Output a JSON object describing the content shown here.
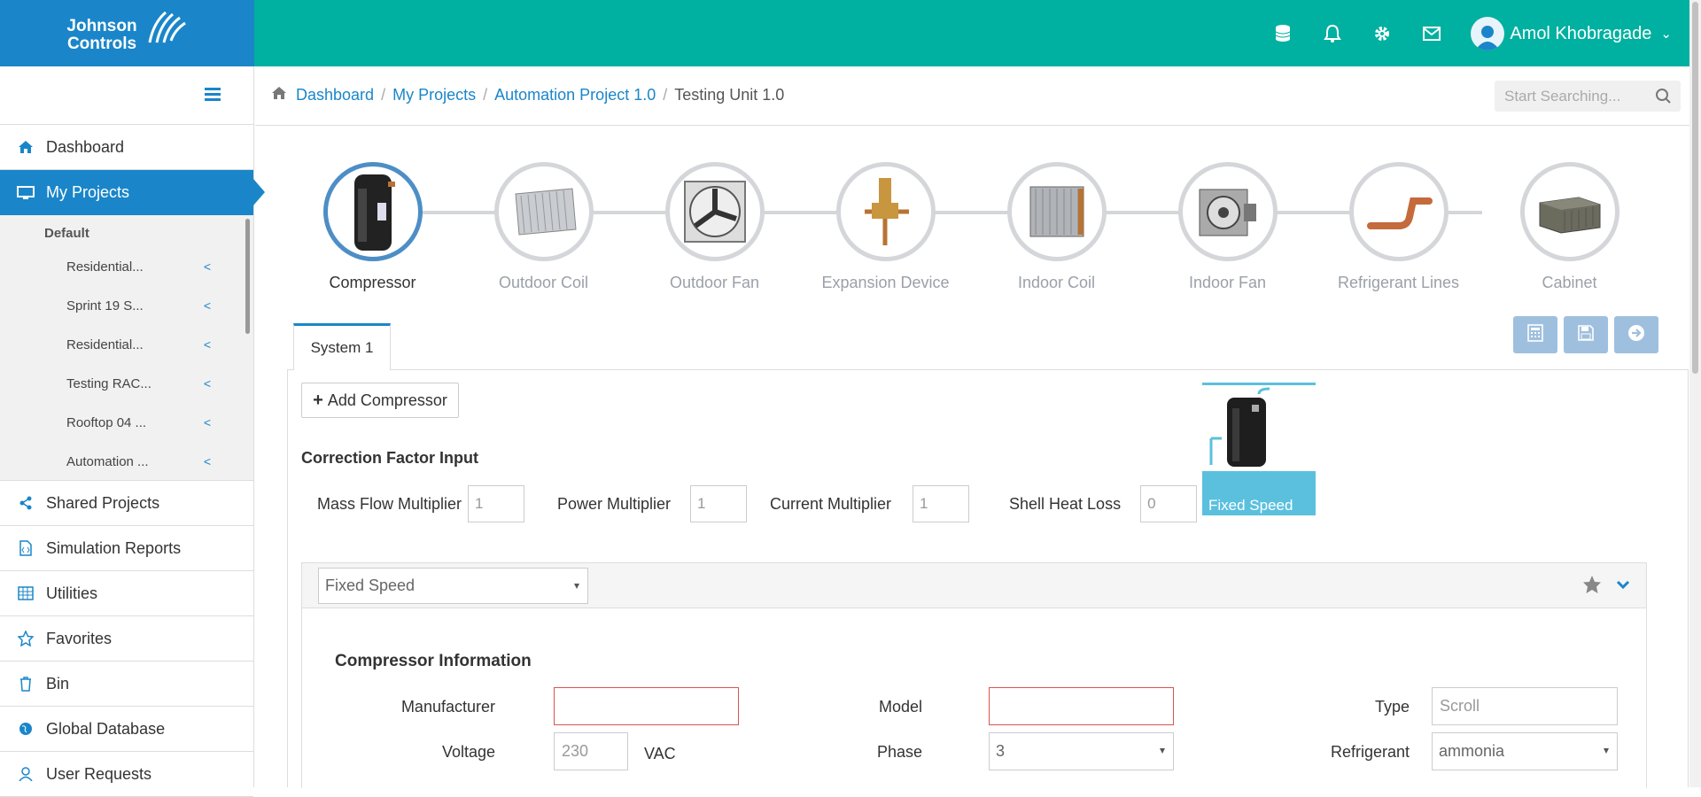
{
  "brand": {
    "line1": "Johnson",
    "line2": "Controls"
  },
  "user": {
    "name": "Amol Khobragade"
  },
  "sidebar": {
    "items_top": [
      {
        "label": "Dashboard",
        "icon": "home-icon"
      },
      {
        "label": "My Projects",
        "icon": "monitor-icon"
      }
    ],
    "group": "Default",
    "projects": [
      "Residential...",
      "Sprint 19 S...",
      "Residential...",
      "Testing RAC...",
      "Rooftop 04 ...",
      "Automation ..."
    ],
    "items_bottom": [
      {
        "label": "Shared Projects",
        "icon": "share-icon"
      },
      {
        "label": "Simulation Reports",
        "icon": "report-icon"
      },
      {
        "label": "Utilities",
        "icon": "grid-icon"
      },
      {
        "label": "Favorites",
        "icon": "star-icon"
      },
      {
        "label": "Bin",
        "icon": "trash-icon"
      },
      {
        "label": "Global Database",
        "icon": "globe-icon"
      },
      {
        "label": "User Requests",
        "icon": "user-icon"
      }
    ]
  },
  "breadcrumb": [
    "Dashboard",
    "My Projects",
    "Automation Project 1.0",
    "Testing Unit 1.0"
  ],
  "search": {
    "placeholder": "Start Searching..."
  },
  "steps": [
    "Compressor",
    "Outdoor Coil",
    "Outdoor Fan",
    "Expansion Device",
    "Indoor Coil",
    "Indoor Fan",
    "Refrigerant Lines",
    "Cabinet"
  ],
  "tab": "System 1",
  "add_compressor": "Add Compressor",
  "correction": {
    "title": "Correction Factor Input",
    "fields": [
      {
        "label": "Mass Flow Multiplier",
        "value": "1"
      },
      {
        "label": "Power Multiplier",
        "value": "1"
      },
      {
        "label": "Current Multiplier",
        "value": "1"
      },
      {
        "label": "Shell Heat Loss",
        "value": "0"
      }
    ]
  },
  "card": {
    "label": "Fixed Speed"
  },
  "speed_select": "Fixed Speed",
  "compressor_info": {
    "title": "Compressor Information",
    "manufacturer_label": "Manufacturer",
    "manufacturer": "",
    "model_label": "Model",
    "model": "",
    "type_label": "Type",
    "type": "Scroll",
    "voltage_label": "Voltage",
    "voltage": "230",
    "voltage_unit": "VAC",
    "phase_label": "Phase",
    "phase": "3",
    "refrigerant_label": "Refrigerant",
    "refrigerant": "ammonia"
  }
}
